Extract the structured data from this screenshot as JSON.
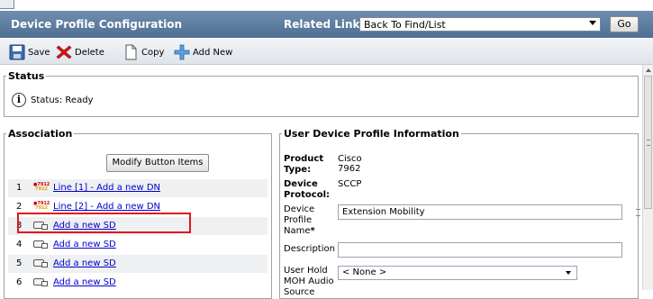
{
  "header": {
    "title": "Device Profile Configuration",
    "related_links_label": "Related Links:",
    "related_links_value": "Back To Find/List",
    "go_label": "Go"
  },
  "toolbar": {
    "save_label": "Save",
    "delete_label": "Delete",
    "copy_label": "Copy",
    "add_new_label": "Add New"
  },
  "status": {
    "legend": "Status",
    "text": "Status: Ready"
  },
  "association": {
    "legend": "Association",
    "modify_button_label": "Modify Button Items",
    "rows": [
      {
        "index": "1",
        "icon": "line-icon",
        "label": "Line [1] - Add a new DN"
      },
      {
        "index": "2",
        "icon": "line-icon",
        "label": "Line [2] - Add a new DN"
      },
      {
        "index": "3",
        "icon": "speed-dial-icon",
        "label": "Add a new SD"
      },
      {
        "index": "4",
        "icon": "speed-dial-icon",
        "label": "Add a new SD"
      },
      {
        "index": "5",
        "icon": "speed-dial-icon",
        "label": "Add a new SD"
      },
      {
        "index": "6",
        "icon": "speed-dial-icon",
        "label": "Add a new SD"
      }
    ]
  },
  "user_device_profile": {
    "legend": "User Device Profile Information",
    "product_type_label": "Product Type:",
    "product_type_value": "Cisco 7962",
    "device_protocol_label": "Device Protocol:",
    "device_protocol_value": "SCCP",
    "device_profile_name_label": "Device Profile Name",
    "device_profile_name_value": "Extension Mobility",
    "required_marker": "*",
    "description_label": "Description",
    "description_value": "",
    "user_hold_moh_label": "User Hold MOH Audio Source",
    "user_hold_moh_value": "< None >"
  },
  "colors": {
    "header_bg": "#5b7ba0",
    "link": "#0000cc",
    "highlight": "#e0141e"
  }
}
